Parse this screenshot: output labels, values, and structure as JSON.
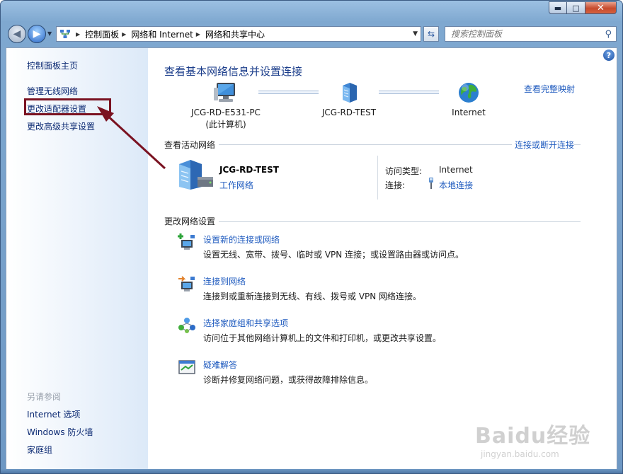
{
  "window": {
    "caption_buttons": {
      "minimize": "▬",
      "maximize": "□",
      "close": "✕"
    }
  },
  "navbar": {
    "back_glyph": "◀",
    "forward_glyph": "▶",
    "breadcrumbs": [
      "控制面板",
      "网络和 Internet",
      "网络和共享中心"
    ],
    "search_placeholder": "搜索控制面板"
  },
  "sidebar": {
    "items": [
      {
        "label": "控制面板主页"
      },
      {
        "label": "管理无线网络"
      },
      {
        "label": "更改适配器设置"
      },
      {
        "label": "更改高级共享设置"
      }
    ],
    "see_also_heading": "另请参阅",
    "see_also": [
      {
        "label": "Internet 选项"
      },
      {
        "label": "Windows 防火墙"
      },
      {
        "label": "家庭组"
      }
    ]
  },
  "main": {
    "title": "查看基本网络信息并设置连接",
    "map_link": "查看完整映射",
    "network_map": {
      "computer_name": "JCG-RD-E531-PC",
      "computer_sub": "(此计算机)",
      "network_name": "JCG-RD-TEST",
      "internet_label": "Internet"
    },
    "active_networks": {
      "heading": "查看活动网络",
      "connect_link": "连接或断开连接",
      "name": "JCG-RD-TEST",
      "type": "工作网络",
      "access_type_label": "访问类型:",
      "access_type_value": "Internet",
      "connections_label": "连接:",
      "connections_value": "本地连接"
    },
    "change_settings": {
      "heading": "更改网络设置",
      "tasks": [
        {
          "link": "设置新的连接或网络",
          "desc": "设置无线、宽带、拨号、临时或 VPN 连接；或设置路由器或访问点。",
          "icon": "new-connection-icon"
        },
        {
          "link": "连接到网络",
          "desc": "连接到或重新连接到无线、有线、拨号或 VPN 网络连接。",
          "icon": "connect-network-icon"
        },
        {
          "link": "选择家庭组和共享选项",
          "desc": "访问位于其他网络计算机上的文件和打印机，或更改共享设置。",
          "icon": "homegroup-icon"
        },
        {
          "link": "疑难解答",
          "desc": "诊断并修复网络问题，或获得故障排除信息。",
          "icon": "troubleshoot-icon"
        }
      ]
    }
  },
  "watermark": {
    "brand": "Baidu经验",
    "url": "jingyan.baidu.com"
  },
  "colors": {
    "link": "#1f5bbf",
    "title": "#1a3c8a",
    "highlight_box": "#7a1221"
  }
}
